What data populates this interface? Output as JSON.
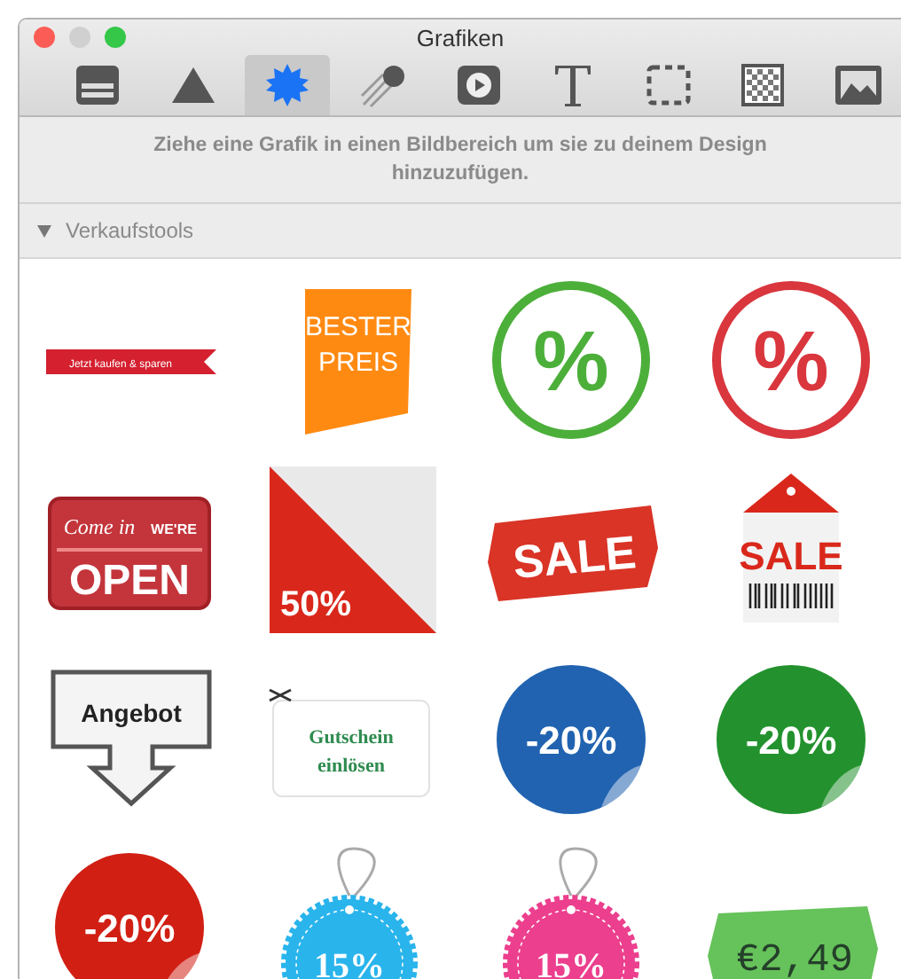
{
  "window": {
    "title": "Grafiken"
  },
  "toolbar": [
    {
      "kind": "table",
      "selected": false
    },
    {
      "kind": "shape",
      "selected": false
    },
    {
      "kind": "starburst",
      "selected": true
    },
    {
      "kind": "comet",
      "selected": false
    },
    {
      "kind": "media",
      "selected": false
    },
    {
      "kind": "text",
      "selected": false
    },
    {
      "kind": "frame",
      "selected": false
    },
    {
      "kind": "pattern",
      "selected": false
    },
    {
      "kind": "image",
      "selected": false
    }
  ],
  "hint": "Ziehe eine Grafik in einen Bildbereich um sie zu deinem Design hinzuzufügen.",
  "section": {
    "title": "Verkaufstools",
    "expanded": true
  },
  "graphics": [
    {
      "kind": "ribbon",
      "lines": [
        "Jetzt kaufen & sparen"
      ]
    },
    {
      "kind": "flag",
      "lines": [
        "BESTER",
        "PREIS"
      ]
    },
    {
      "kind": "stamp",
      "color": "#4caf3a",
      "lines": [
        "%"
      ]
    },
    {
      "kind": "stamp",
      "color": "#d9363e",
      "lines": [
        "%"
      ]
    },
    {
      "kind": "sign",
      "lines": [
        "Come in",
        "WE'RE",
        "OPEN"
      ]
    },
    {
      "kind": "corner",
      "lines": [
        "50%"
      ]
    },
    {
      "kind": "torn",
      "lines": [
        "SALE"
      ]
    },
    {
      "kind": "hangtag",
      "lines": [
        "SALE"
      ]
    },
    {
      "kind": "arrowbox",
      "lines": [
        "Angebot"
      ]
    },
    {
      "kind": "coupon",
      "lines": [
        "Gutschein",
        "einlösen"
      ]
    },
    {
      "kind": "sticker",
      "color": "#2163b0",
      "lines": [
        "-20%"
      ]
    },
    {
      "kind": "sticker",
      "color": "#23922e",
      "lines": [
        "-20%"
      ]
    },
    {
      "kind": "sticker",
      "color": "#d11f14",
      "lines": [
        "-20%"
      ]
    },
    {
      "kind": "scallop",
      "color": "#29b4ec",
      "lines": [
        "15%"
      ]
    },
    {
      "kind": "scallop",
      "color": "#ec3f8e",
      "lines": [
        "15%"
      ]
    },
    {
      "kind": "pricetag",
      "lines": [
        "€2,49"
      ]
    }
  ]
}
